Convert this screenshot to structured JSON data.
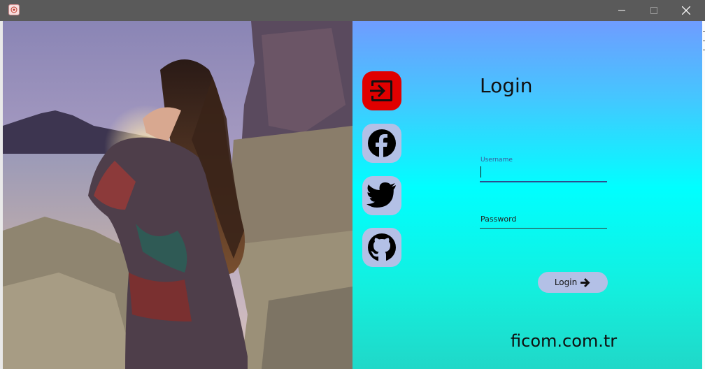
{
  "window": {
    "app_icon": "app-logo-icon",
    "controls": {
      "minimize": "minimize-icon",
      "maximize": "maximize-icon",
      "close": "close-icon"
    }
  },
  "photo": {
    "subject": "woman-with-long-hair-on-rocks-photo"
  },
  "social": [
    {
      "name": "login-icon",
      "color": "#e00000"
    },
    {
      "name": "facebook-icon",
      "color": "#b3c0e6"
    },
    {
      "name": "twitter-icon",
      "color": "#b3c0e6"
    },
    {
      "name": "github-icon",
      "color": "#b3c0e6"
    }
  ],
  "form": {
    "title": "Login",
    "username_label": "Username",
    "username_value": "",
    "password_placeholder": "Password",
    "password_value": "",
    "submit_label": "Login",
    "submit_icon": "arrow-right-icon"
  },
  "brand": "ficom.com.tr",
  "colors": {
    "gradient_top": "#6f9cff",
    "gradient_mid": "#00ffff",
    "gradient_bottom": "#20d8c8",
    "login_accent": "#e00000",
    "button_bg": "#b3c0e6"
  }
}
